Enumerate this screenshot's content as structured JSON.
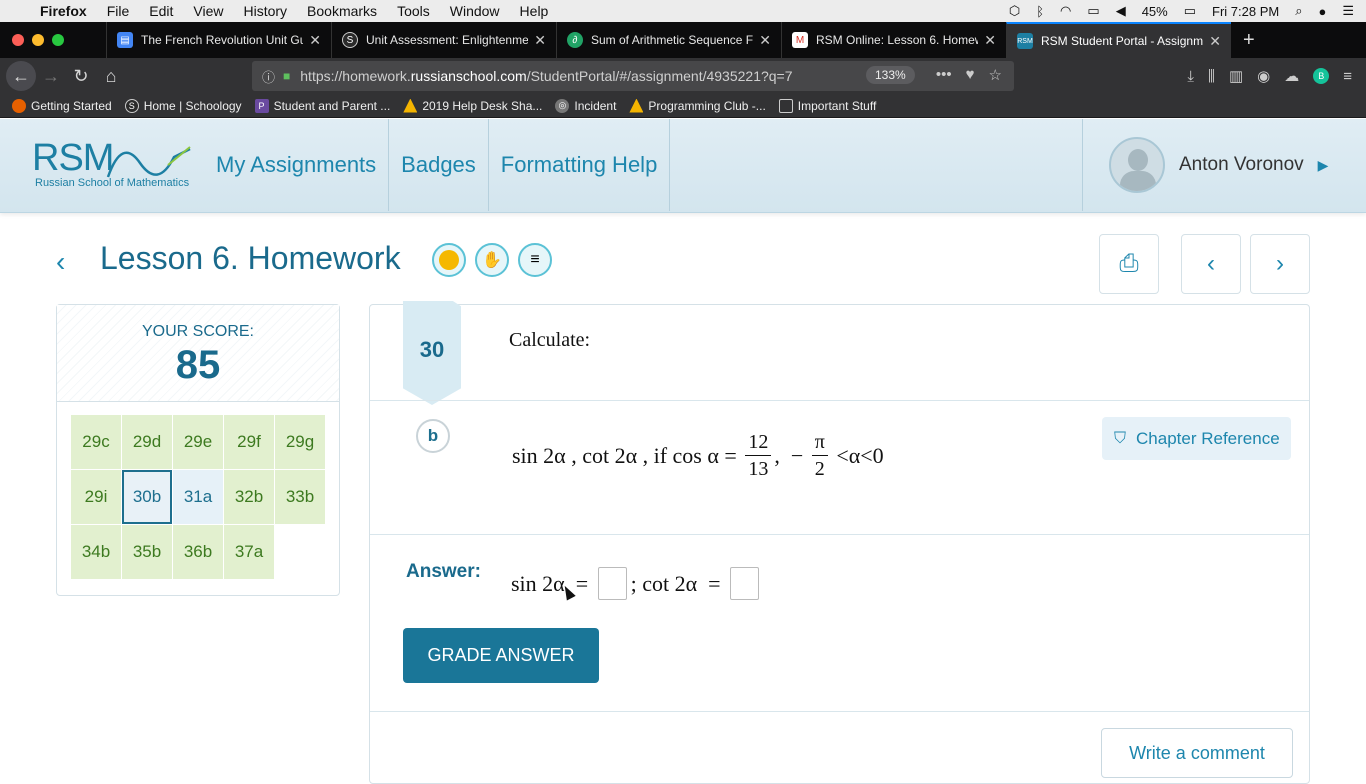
{
  "macmenu": {
    "app": "Firefox",
    "items": [
      "File",
      "Edit",
      "View",
      "History",
      "Bookmarks",
      "Tools",
      "Window",
      "Help"
    ],
    "battery": "45%",
    "clock": "Fri 7:28 PM"
  },
  "tabs": [
    {
      "title": "The French Revolution Unit Gui",
      "color": "#4285f4",
      "glyph": "▤"
    },
    {
      "title": "Unit Assessment: Enlightenmen",
      "color": "#2b2b2b",
      "glyph": "S"
    },
    {
      "title": "Sum of Arithmetic Sequence Fo",
      "color": "#21a366",
      "glyph": "∂"
    },
    {
      "title": "RSM Online: Lesson 6. Homewo",
      "color": "#d93025",
      "glyph": "M"
    },
    {
      "title": "RSM Student Portal - Assignme",
      "color": "#1d7fa3",
      "glyph": "R"
    }
  ],
  "urlbar": {
    "prefix": "https://homework.",
    "domain": "russianschool.com",
    "path": "/StudentPortal/#/assignment/4935221?q=7",
    "zoom": "133%"
  },
  "bookmarks": [
    {
      "label": "Getting Started",
      "color": "#e66000"
    },
    {
      "label": "Home | Schoology",
      "color": "#2b2b2b"
    },
    {
      "label": "Student and Parent ...",
      "color": "#6a4aa0"
    },
    {
      "label": "2019 Help Desk Sha...",
      "color": "#f4b400"
    },
    {
      "label": "Incident",
      "color": "#777777"
    },
    {
      "label": "Programming Club -...",
      "color": "#f4b400"
    },
    {
      "label": "Important Stuff",
      "color": "#777777"
    }
  ],
  "site": {
    "logo": "RSM",
    "logo_sub": "Russian School of Mathematics",
    "nav": [
      "My Assignments",
      "Badges",
      "Formatting Help"
    ],
    "user": "Anton Voronov"
  },
  "lesson": {
    "title": "Lesson 6. Homework"
  },
  "score": {
    "label": "YOUR SCORE:",
    "value": "85",
    "problems": [
      {
        "label": "29c",
        "state": "done"
      },
      {
        "label": "29d",
        "state": "done"
      },
      {
        "label": "29e",
        "state": "done"
      },
      {
        "label": "29f",
        "state": "done"
      },
      {
        "label": "29g",
        "state": "done"
      },
      {
        "label": "29i",
        "state": "done"
      },
      {
        "label": "30b",
        "state": "current"
      },
      {
        "label": "31a",
        "state": "pending"
      },
      {
        "label": "32b",
        "state": "done"
      },
      {
        "label": "33b",
        "state": "done"
      },
      {
        "label": "34b",
        "state": "done"
      },
      {
        "label": "35b",
        "state": "done"
      },
      {
        "label": "36b",
        "state": "done"
      },
      {
        "label": "37a",
        "state": "done"
      }
    ]
  },
  "problem": {
    "number": "30",
    "instruction": "Calculate:",
    "part": "b",
    "formula": {
      "lead": "sin 2α , cot 2α , if cos α = ",
      "frac1_num": "12",
      "frac1_den": "13",
      "mid": ",  − ",
      "frac2_num": "π",
      "frac2_den": "2",
      "tail": " <α<0"
    },
    "chapter_reference": "Chapter Reference",
    "answer_label": "Answer:",
    "answer_part1": "sin 2α  = ",
    "answer_part2": "; cot 2α  = ",
    "grade_button": "GRADE ANSWER",
    "comment_button": "Write a comment"
  }
}
